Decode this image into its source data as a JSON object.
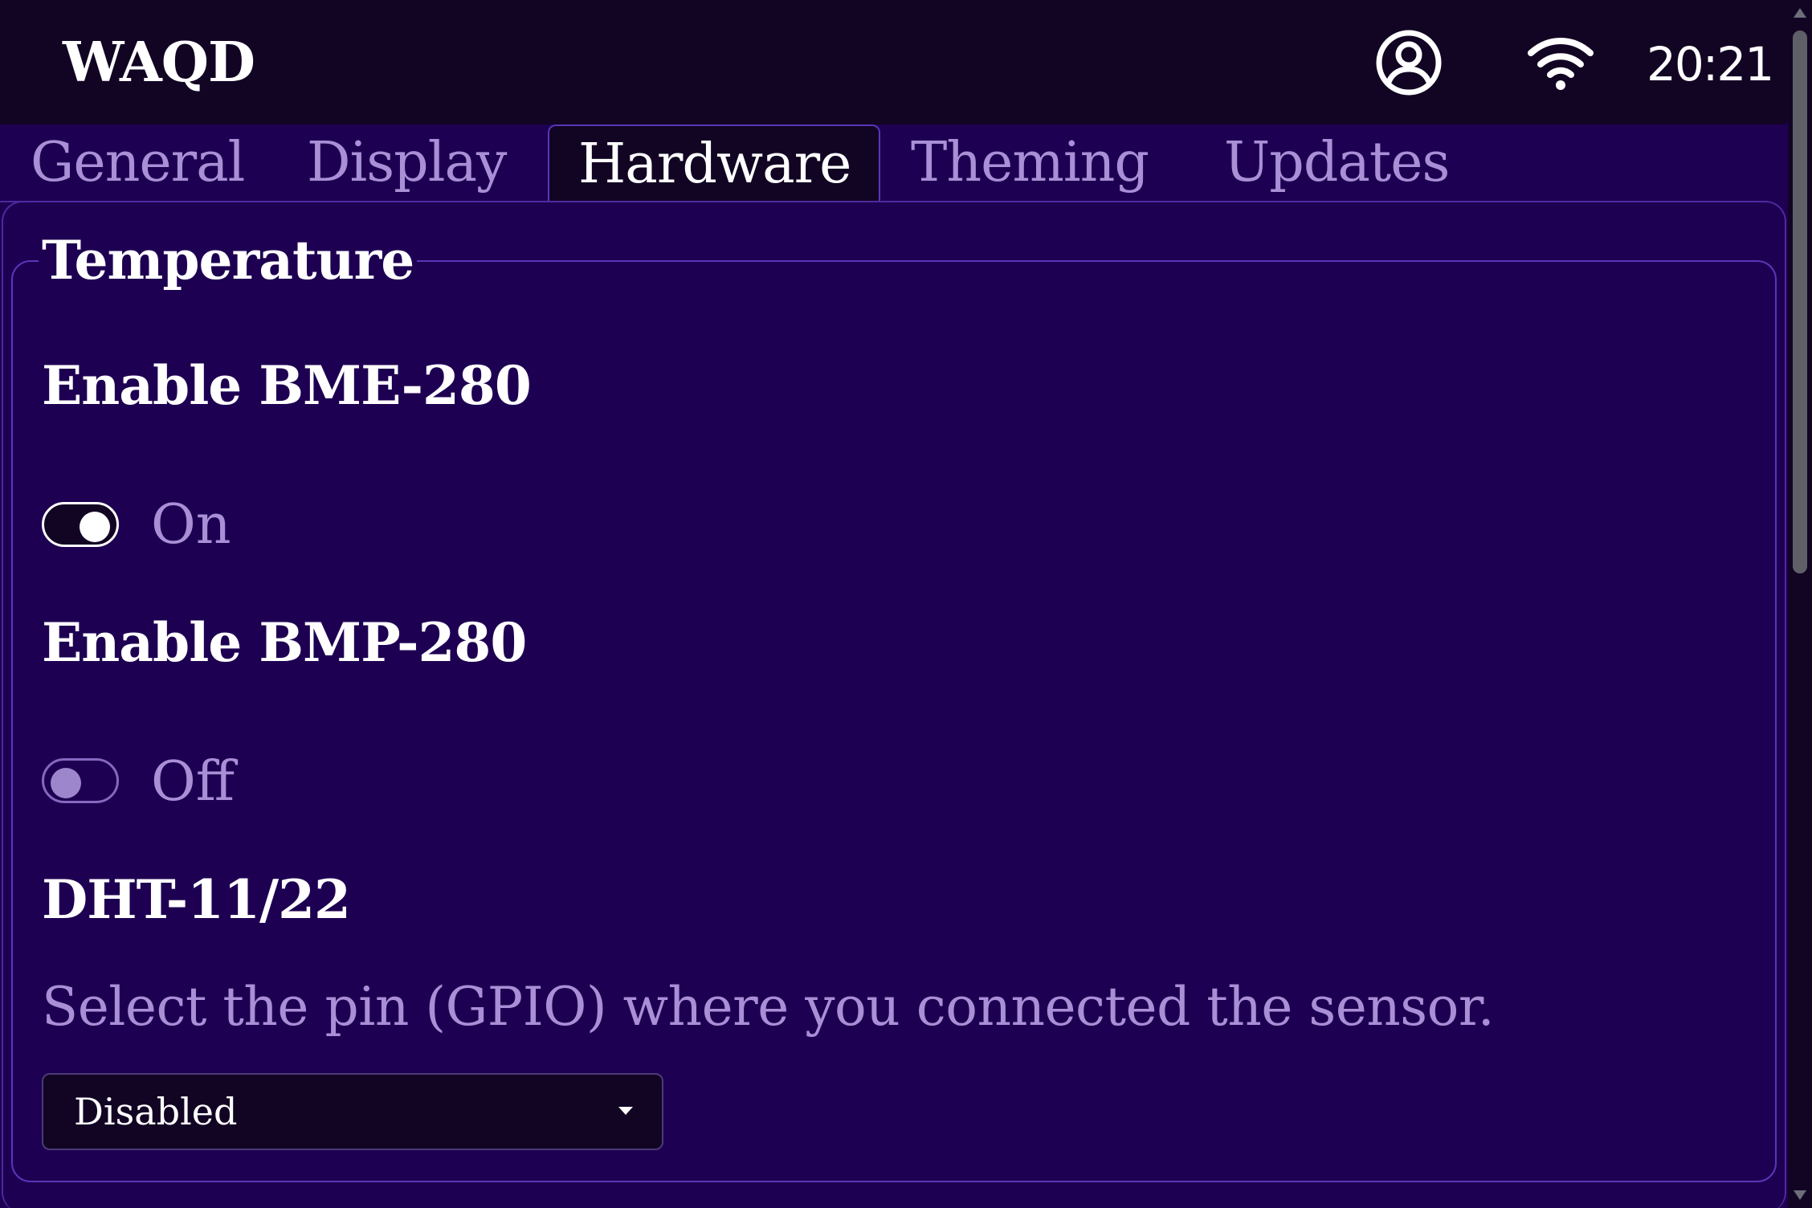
{
  "header": {
    "app_title": "WAQD",
    "account_icon": "account-circle-icon",
    "wifi_icon": "wifi-icon",
    "clock": "20:21"
  },
  "tabs": [
    {
      "label": "General",
      "active": false
    },
    {
      "label": "Display",
      "active": false
    },
    {
      "label": "Hardware",
      "active": true
    },
    {
      "label": "Theming",
      "active": false
    },
    {
      "label": "Updates",
      "active": false
    }
  ],
  "section": {
    "legend": "Temperature",
    "bme280": {
      "title": "Enable BME-280",
      "state": "On",
      "enabled": true
    },
    "bmp280": {
      "title": "Enable BMP-280",
      "state": "Off",
      "enabled": false
    },
    "dht": {
      "title": "DHT-11/22",
      "help": "Select the pin (GPIO) where you connected the sensor.",
      "pin_value": "Disabled"
    }
  },
  "colors": {
    "background": "#1e0052",
    "topbar": "#120524",
    "muted_text": "#a88fd6",
    "border": "#5a35b8"
  }
}
